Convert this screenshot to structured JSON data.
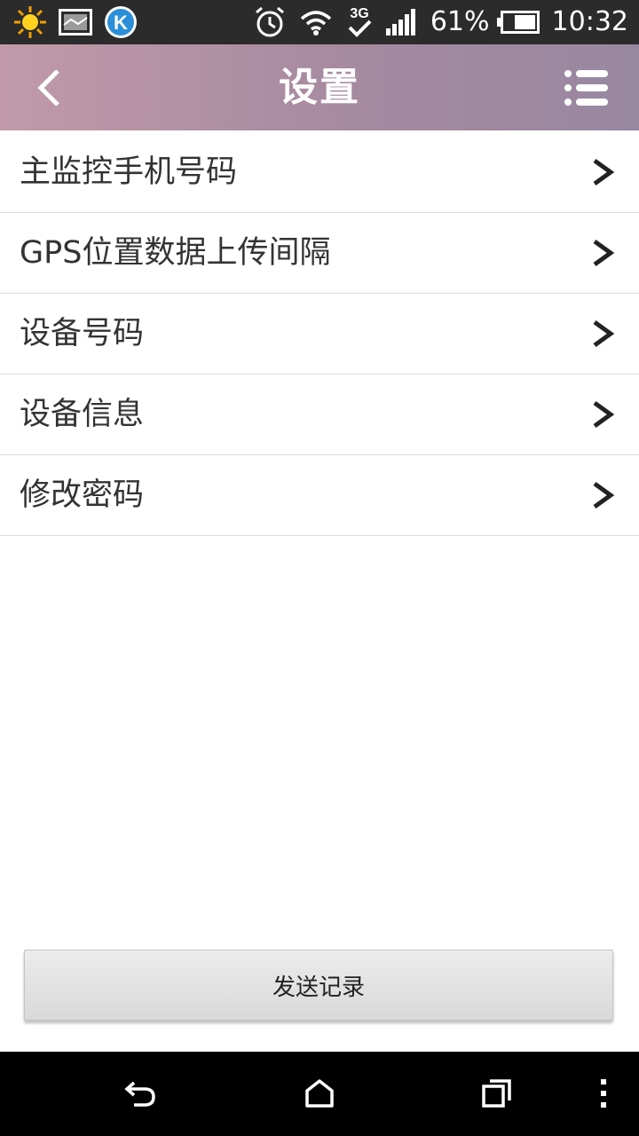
{
  "status_bar": {
    "icons_left": [
      "weather-sun-icon",
      "gallery-icon",
      "kugou-app-icon"
    ],
    "icons_right": [
      "alarm-icon",
      "wifi-icon",
      "3g-data-icon",
      "signal-icon",
      "battery-icon"
    ],
    "network_type": "3G",
    "battery_percent": "61%",
    "time": "10:32"
  },
  "header": {
    "title": "设置",
    "back_icon": "chevron-left-icon",
    "menu_icon": "list-menu-icon"
  },
  "settings_list": [
    {
      "label": "主监控手机号码",
      "icon": "chevron-right-icon"
    },
    {
      "label": "GPS位置数据上传间隔",
      "icon": "chevron-right-icon"
    },
    {
      "label": "设备号码",
      "icon": "chevron-right-icon"
    },
    {
      "label": "设备信息",
      "icon": "chevron-right-icon"
    },
    {
      "label": "修改密码",
      "icon": "chevron-right-icon"
    }
  ],
  "send_button": {
    "label": "发送记录"
  },
  "nav_bar": {
    "icons": [
      "back-icon",
      "home-icon",
      "recent-apps-icon",
      "overflow-menu-icon"
    ]
  },
  "colors": {
    "status_bar_bg": "#2b2b2b",
    "header_gradient_start": "#c09aa8",
    "header_gradient_end": "#9887a0",
    "list_text": "#333333",
    "divider": "#dedede",
    "nav_bar_bg": "#000000"
  }
}
